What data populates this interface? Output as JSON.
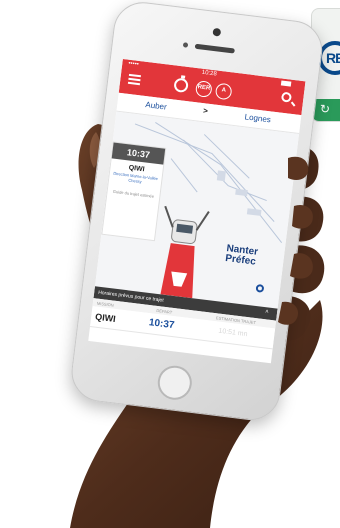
{
  "app": {
    "status_time": "10:28",
    "status_dots": "•••••",
    "rer_label": "RER",
    "line_label": "A",
    "colors": {
      "brand_red": "#e2363a",
      "accent_blue": "#1a4e9c",
      "icon_green": "#2a9a5a"
    }
  },
  "route": {
    "from": "Auber",
    "arrow": ">",
    "to": "Lognes"
  },
  "train_panel": {
    "time": "10:37",
    "code": "QIWI",
    "destination": "Direction Marne-la-Vallée Chessy",
    "stop_note": "Guide du trajet estimée"
  },
  "map": {
    "station": [
      "Nanter",
      "Préfec"
    ]
  },
  "schedule": {
    "header": "Horaires prévus pour ce trajet",
    "columns": [
      "MISSION",
      "DÉPART",
      "ESTIMATION TRAJET"
    ],
    "rows": [
      {
        "code": "QIWI",
        "departure": "10:37",
        "estimate": "10:51 mn"
      }
    ]
  },
  "icons": [
    "menu-icon",
    "timer-icon",
    "rer-icon",
    "line-a-icon",
    "search-icon",
    "locate-icon"
  ],
  "app_icon": {
    "logo_text": "RE",
    "band_text": "↻"
  }
}
